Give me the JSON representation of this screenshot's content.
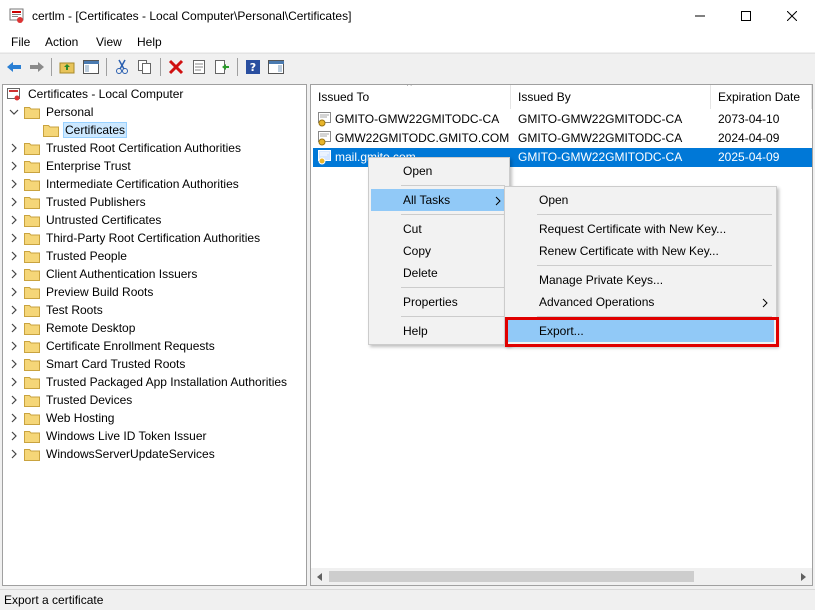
{
  "window": {
    "title": "certlm - [Certificates - Local Computer\\Personal\\Certificates]",
    "minimize_icon": "minimize-icon",
    "maximize_icon": "maximize-icon",
    "close_icon": "close-icon"
  },
  "menubar": {
    "items": [
      "File",
      "Action",
      "View",
      "Help"
    ]
  },
  "tree": {
    "root": "Certificates - Local Computer",
    "personal": "Personal",
    "certificates": "Certificates",
    "items": [
      "Trusted Root Certification Authorities",
      "Enterprise Trust",
      "Intermediate Certification Authorities",
      "Trusted Publishers",
      "Untrusted Certificates",
      "Third-Party Root Certification Authorities",
      "Trusted People",
      "Client Authentication Issuers",
      "Preview Build Roots",
      "Test Roots",
      "Remote Desktop",
      "Certificate Enrollment Requests",
      "Smart Card Trusted Roots",
      "Trusted Packaged App Installation Authorities",
      "Trusted Devices",
      "Web Hosting",
      "Windows Live ID Token Issuer",
      "WindowsServerUpdateServices"
    ]
  },
  "list": {
    "columns": [
      "Issued To",
      "Issued By",
      "Expiration Date"
    ],
    "rows": [
      {
        "issued_to": "GMITO-GMW22GMITODC-CA",
        "issued_by": "GMITO-GMW22GMITODC-CA",
        "expiration": "2073-04-10"
      },
      {
        "issued_to": "GMW22GMITODC.GMITO.COM",
        "issued_by": "GMITO-GMW22GMITODC-CA",
        "expiration": "2024-04-09"
      },
      {
        "issued_to": "mail.gmito.com",
        "issued_by": "GMITO-GMW22GMITODC-CA",
        "expiration": "2025-04-09"
      }
    ]
  },
  "context_menu": {
    "open": "Open",
    "all_tasks": "All Tasks",
    "cut": "Cut",
    "copy": "Copy",
    "delete": "Delete",
    "properties": "Properties",
    "help": "Help"
  },
  "submenu": {
    "open": "Open",
    "request_new_key": "Request Certificate with New Key...",
    "renew_new_key": "Renew Certificate with New Key...",
    "manage_private_keys": "Manage Private Keys...",
    "advanced_operations": "Advanced Operations",
    "export": "Export..."
  },
  "status": {
    "text": "Export a certificate"
  },
  "colors": {
    "selection": "#0078d7",
    "menu_highlight": "#91c9f7",
    "annotation_box": "#e00000"
  }
}
